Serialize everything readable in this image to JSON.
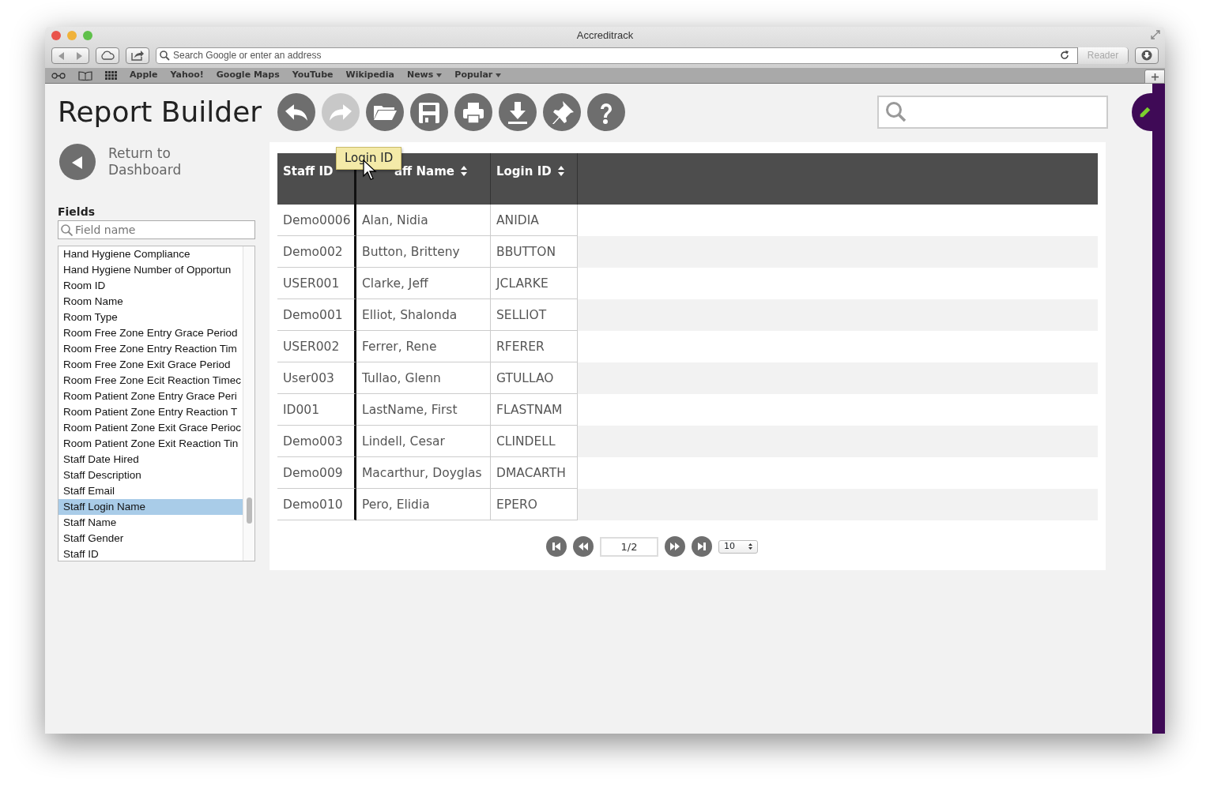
{
  "window": {
    "title": "Accreditrack"
  },
  "toolbar": {
    "address_placeholder": "Search Google or enter an address",
    "reader": "Reader"
  },
  "bookmarks": [
    {
      "label": "Apple",
      "kind": "link"
    },
    {
      "label": "Yahoo!",
      "kind": "link"
    },
    {
      "label": "Google Maps",
      "kind": "link"
    },
    {
      "label": "YouTube",
      "kind": "link"
    },
    {
      "label": "Wikipedia",
      "kind": "link"
    },
    {
      "label": "News",
      "kind": "menu"
    },
    {
      "label": "Popular",
      "kind": "menu"
    }
  ],
  "app": {
    "title": "Report Builder",
    "actions": [
      {
        "kind": "undo",
        "disabled": false
      },
      {
        "kind": "redo",
        "disabled": true
      },
      {
        "kind": "open",
        "disabled": false
      },
      {
        "kind": "save",
        "disabled": false
      },
      {
        "kind": "print",
        "disabled": false
      },
      {
        "kind": "download",
        "disabled": false
      },
      {
        "kind": "pin",
        "disabled": false
      },
      {
        "kind": "help",
        "disabled": false
      }
    ],
    "return_link": "Return to Dashboard"
  },
  "fields": {
    "heading": "Fields",
    "placeholder": "Field name",
    "items": [
      {
        "label": "Hand Hygiene Compliance",
        "selected": false
      },
      {
        "label": "Hand Hygiene Number of Opportun",
        "selected": false
      },
      {
        "label": "Room ID",
        "selected": false
      },
      {
        "label": "Room Name",
        "selected": false
      },
      {
        "label": "Room Type",
        "selected": false
      },
      {
        "label": "Room Free Zone Entry Grace Period",
        "selected": false
      },
      {
        "label": "Room Free Zone Entry Reaction Tim",
        "selected": false
      },
      {
        "label": "Room Free Zone  Exit Grace Period",
        "selected": false
      },
      {
        "label": "Room Free Zone Ecit Reaction Timec",
        "selected": false
      },
      {
        "label": "Room Patient Zone Entry Grace Peri",
        "selected": false
      },
      {
        "label": "Room Patient Zone Entry Reaction T",
        "selected": false
      },
      {
        "label": "Room Patient Zone Exit Grace Perioc",
        "selected": false
      },
      {
        "label": "Room Patient Zone Exit Reaction Tin",
        "selected": false
      },
      {
        "label": "Staff Date Hired",
        "selected": false
      },
      {
        "label": "Staff Description",
        "selected": false
      },
      {
        "label": "Staff Email",
        "selected": false
      },
      {
        "label": "Staff Login Name",
        "selected": true
      },
      {
        "label": "Staff Name",
        "selected": false
      },
      {
        "label": "Staff Gender",
        "selected": false
      },
      {
        "label": "Staff ID",
        "selected": false
      }
    ]
  },
  "table": {
    "columns": [
      {
        "label": "Staff ID",
        "sort_icon": false
      },
      {
        "label": "aff Name",
        "sort_icon": true
      },
      {
        "label": "Login ID",
        "sort_icon": true
      }
    ],
    "drag_tooltip": "Login ID",
    "rows": [
      [
        "Demo0006",
        "Alan, Nidia",
        "ANIDIA"
      ],
      [
        "Demo002",
        "Button, Britteny",
        "BBUTTON"
      ],
      [
        "USER001",
        "Clarke, Jeff",
        "JCLARKE"
      ],
      [
        "Demo001",
        "Elliot, Shalonda",
        "SELLIOT"
      ],
      [
        "USER002",
        "Ferrer, Rene",
        "RFERER"
      ],
      [
        "User003",
        "Tullao, Glenn",
        "GTULLAO"
      ],
      [
        "ID001",
        "LastName, First",
        "FLASTNAM"
      ],
      [
        "Demo003",
        "Lindell, Cesar",
        "CLINDELL"
      ],
      [
        "Demo009",
        "Macarthur, Doyglas",
        "DMACARTH"
      ],
      [
        "Demo010",
        "Pero, Elidia",
        "EPERO"
      ]
    ]
  },
  "pager": {
    "page": "1/2",
    "page_size": "10"
  }
}
